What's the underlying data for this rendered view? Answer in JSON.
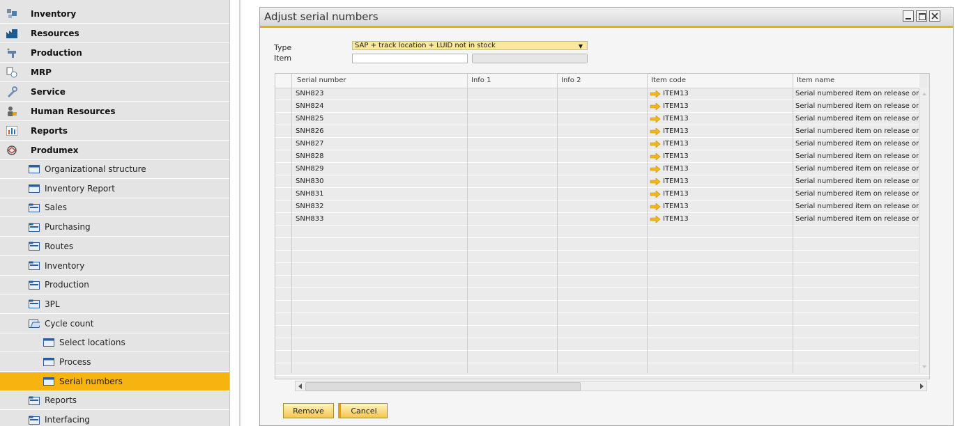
{
  "nav": {
    "modules": [
      {
        "label": "Inventory",
        "icon": "inventory-icon"
      },
      {
        "label": "Resources",
        "icon": "resources-icon"
      },
      {
        "label": "Production",
        "icon": "production-icon"
      },
      {
        "label": "MRP",
        "icon": "mrp-icon"
      },
      {
        "label": "Service",
        "icon": "service-icon"
      },
      {
        "label": "Human Resources",
        "icon": "human-resources-icon"
      },
      {
        "label": "Reports",
        "icon": "reports-icon"
      },
      {
        "label": "Produmex",
        "icon": "produmex-icon"
      }
    ],
    "produmex_items": [
      {
        "label": "Organizational structure",
        "icon": "form-icon",
        "level": 1
      },
      {
        "label": "Inventory Report",
        "icon": "form-icon",
        "level": 1
      },
      {
        "label": "Sales",
        "icon": "folder-icon",
        "level": 1
      },
      {
        "label": "Purchasing",
        "icon": "folder-icon",
        "level": 1
      },
      {
        "label": "Routes",
        "icon": "folder-icon",
        "level": 1
      },
      {
        "label": "Inventory",
        "icon": "folder-icon",
        "level": 1
      },
      {
        "label": "Production",
        "icon": "folder-icon",
        "level": 1
      },
      {
        "label": "3PL",
        "icon": "folder-icon",
        "level": 1
      },
      {
        "label": "Cycle count",
        "icon": "open-folder-icon",
        "level": 1
      },
      {
        "label": "Select locations",
        "icon": "form-icon",
        "level": 2
      },
      {
        "label": "Process",
        "icon": "form-icon",
        "level": 2
      },
      {
        "label": "Serial numbers",
        "icon": "form-icon",
        "level": 2,
        "selected": true
      },
      {
        "label": "Reports",
        "icon": "folder-icon",
        "level": 1
      },
      {
        "label": "Interfacing",
        "icon": "folder-icon",
        "level": 1
      }
    ]
  },
  "window": {
    "title": "Adjust serial numbers",
    "type_label": "Type",
    "type_value": "SAP + track location + LUID not in stock",
    "item_label": "Item",
    "item_value": ""
  },
  "grid": {
    "columns": [
      "Serial number",
      "Info 1",
      "Info 2",
      "Item code",
      "Item name"
    ],
    "rows": [
      [
        "SNH823",
        "",
        "",
        "ITEM13",
        "Serial numbered item on release only"
      ],
      [
        "SNH824",
        "",
        "",
        "ITEM13",
        "Serial numbered item on release only"
      ],
      [
        "SNH825",
        "",
        "",
        "ITEM13",
        "Serial numbered item on release only"
      ],
      [
        "SNH826",
        "",
        "",
        "ITEM13",
        "Serial numbered item on release only"
      ],
      [
        "SNH827",
        "",
        "",
        "ITEM13",
        "Serial numbered item on release only"
      ],
      [
        "SNH828",
        "",
        "",
        "ITEM13",
        "Serial numbered item on release only"
      ],
      [
        "SNH829",
        "",
        "",
        "ITEM13",
        "Serial numbered item on release only"
      ],
      [
        "SNH830",
        "",
        "",
        "ITEM13",
        "Serial numbered item on release only"
      ],
      [
        "SNH831",
        "",
        "",
        "ITEM13",
        "Serial numbered item on release only"
      ],
      [
        "SNH832",
        "",
        "",
        "ITEM13",
        "Serial numbered item on release only"
      ],
      [
        "SNH833",
        "",
        "",
        "ITEM13",
        "Serial numbered item on release only"
      ]
    ]
  },
  "buttons": {
    "remove": "Remove",
    "cancel": "Cancel"
  },
  "colors": {
    "accent": "#f7b30f",
    "nav_bg": "#e4e4e4",
    "type_field": "#fbe89a",
    "link_arrow": "#f2b818"
  }
}
